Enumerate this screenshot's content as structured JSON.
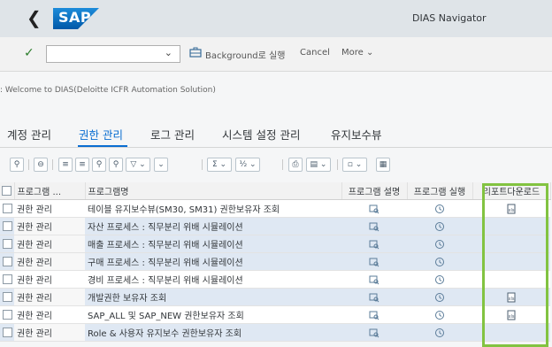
{
  "shell": {
    "back_icon": "chevron-left-icon",
    "logo": "SAP",
    "title": "DIAS Navigator"
  },
  "toolbar": {
    "command_placeholder": "",
    "background_label": "Background로 실행",
    "cancel_label": "Cancel",
    "more_label": "More"
  },
  "welcome": ": Welcome to DIAS(Deloitte ICFR Automation Solution)",
  "tabs": [
    "계정 관리",
    "권한 관리",
    "로그 관리",
    "시스템 설정 관리",
    "유지보수뷰"
  ],
  "selected_tab": "권한 관리",
  "table": {
    "headers": [
      "프로그램 ...",
      "프로그램명",
      "프로그램 설명",
      "프로그램 실행",
      "리포트다운로드"
    ],
    "rows": [
      {
        "group": "권한 관리",
        "name": "테이블 유지보수뷰(SM30, SM31) 권한보유자 조회",
        "download": true,
        "style": "white"
      },
      {
        "group": "권한 관리",
        "name": "자산 프로세스 : 직무분리 위배 시뮬레이션",
        "download": false,
        "style": "blue"
      },
      {
        "group": "권한 관리",
        "name": "매출 프로세스 : 직무분리 위배 시뮬레이션",
        "download": false,
        "style": "blue"
      },
      {
        "group": "권한 관리",
        "name": "구매 프로세스 : 직무분리 위배 시뮬레이션",
        "download": false,
        "style": "blue"
      },
      {
        "group": "권한 관리",
        "name": "경비 프로세스 : 직무분리 위배 시뮬레이션",
        "download": false,
        "style": "white"
      },
      {
        "group": "권한 관리",
        "name": "개발권한 보유자 조회",
        "download": true,
        "style": "blue"
      },
      {
        "group": "권한 관리",
        "name": "SAP_ALL 및 SAP_NEW 권한보유자 조회",
        "download": true,
        "style": "white"
      },
      {
        "group": "권한 관리",
        "name": "Role & 사용자 유지보수 권한보유자 조회",
        "download": false,
        "style": "blue"
      }
    ]
  },
  "colors": {
    "accent": "#0a6ed1",
    "highlight": "#82c341",
    "row_blue": "#dfe8f3"
  }
}
